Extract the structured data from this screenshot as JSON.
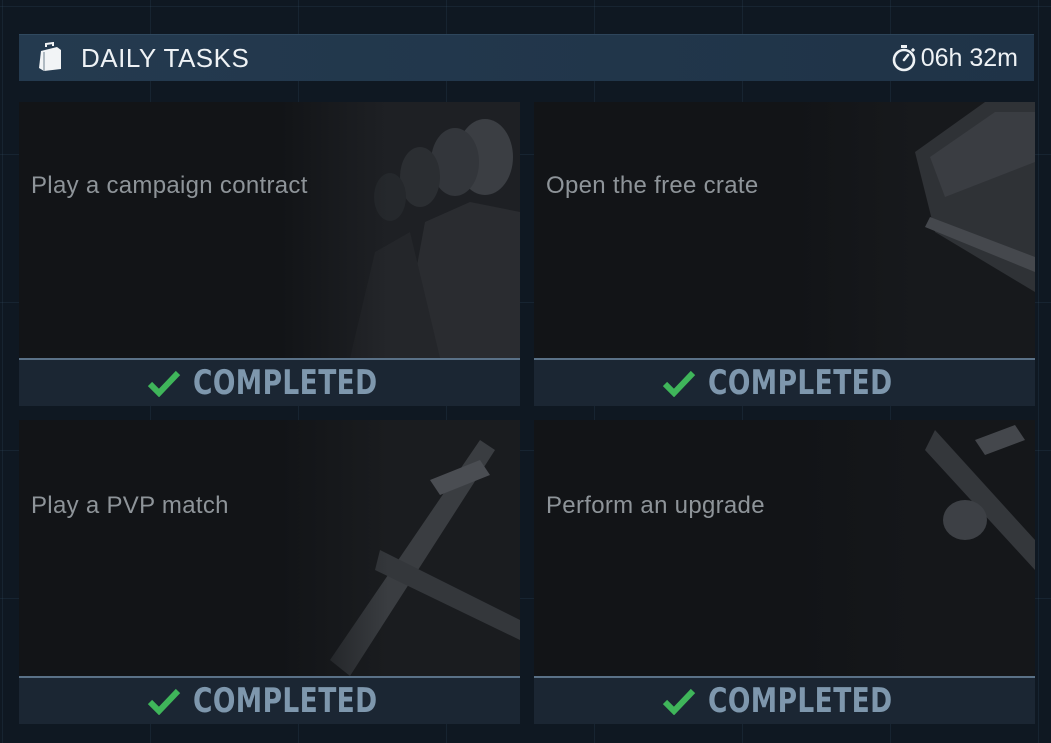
{
  "header": {
    "title": "DAILY TASKS",
    "timer": "06h 32m"
  },
  "tasks": [
    {
      "label": "Play a campaign contract",
      "status": "COMPLETED",
      "art": "people-icon"
    },
    {
      "label": "Open the free crate",
      "status": "COMPLETED",
      "art": "crate-icon"
    },
    {
      "label": "Play a PVP match",
      "status": "COMPLETED",
      "art": "rifle-icon"
    },
    {
      "label": "Perform an upgrade",
      "status": "COMPLETED",
      "art": "rifle-icon"
    }
  ],
  "colors": {
    "check": "#3fb55a",
    "status_text": "#7e97ad",
    "header_bg": "#243a4f"
  }
}
